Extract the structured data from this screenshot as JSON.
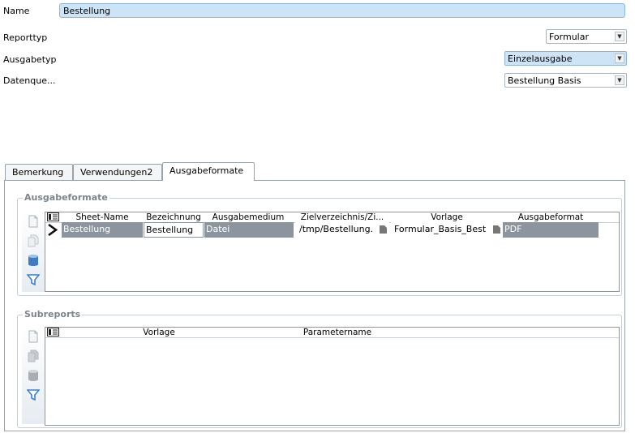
{
  "form": {
    "name_label": "Name",
    "name_value": "Bestellung",
    "reporttyp_label": "Reporttyp",
    "reporttyp_value": "Formular",
    "ausgabetyp_label": "Ausgabetyp",
    "ausgabetyp_value": "Einzelausgabe",
    "datenquelle_label": "Datenque...",
    "datenquelle_value": "Bestellung Basis"
  },
  "tabs": [
    {
      "label": "Bemerkung"
    },
    {
      "label": "Verwendungen2"
    },
    {
      "label": "Ausgabeformate",
      "active": true
    }
  ],
  "ausgabeformate": {
    "title": "Ausgabeformate",
    "columns": [
      "Sheet-Name",
      "Bezeichnung",
      "Ausgabemedium",
      "Zielverzeichnis/Zi...",
      "Vorlage",
      "Ausgabeformat"
    ],
    "rows": [
      {
        "sheet": "Bestellung",
        "bezeichnung": "Bestellung",
        "medium": "Datei",
        "ziel": "/tmp/Bestellung.",
        "vorlage": "Formular_Basis_Best",
        "format": "PDF"
      }
    ]
  },
  "subreports": {
    "title": "Subreports",
    "columns": [
      "Vorlage",
      "Parametername"
    ]
  },
  "toolbar_icons": [
    "new-icon",
    "copy-icon",
    "delete-icon",
    "filter-icon"
  ],
  "colors": {
    "selection": "#cde4f7",
    "row_dark": "#8c959e",
    "filter": "#3a7fd0"
  }
}
